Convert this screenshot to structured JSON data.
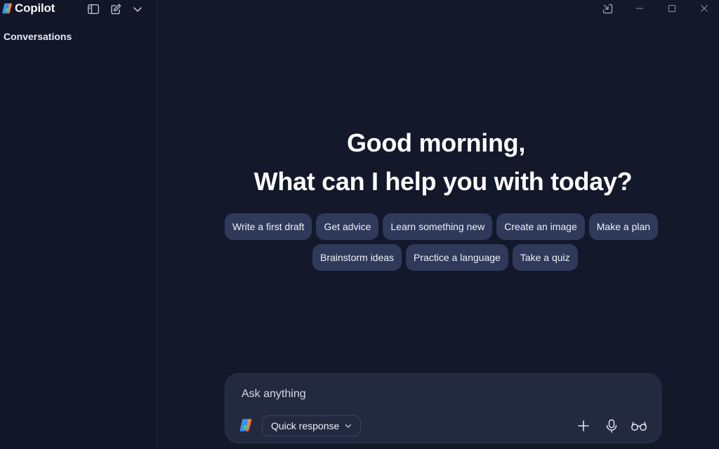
{
  "app": {
    "title": "Copilot"
  },
  "sidebar": {
    "heading": "Conversations"
  },
  "greeting": {
    "line1": "Good morning,",
    "line2": "What can I help you with today?"
  },
  "suggestions": {
    "row1": [
      "Write a first draft",
      "Get advice",
      "Learn something new",
      "Create an image",
      "Make a plan"
    ],
    "row2": [
      "Brainstorm ideas",
      "Practice a language",
      "Take a quiz"
    ]
  },
  "composer": {
    "placeholder": "Ask anything",
    "mode": "Quick response"
  },
  "icons": {
    "toolbar": [
      "sidebar-toggle-icon",
      "new-chat-icon",
      "chevron-down-icon"
    ],
    "window": [
      "pop-out-icon",
      "minimize-icon",
      "maximize-icon",
      "close-icon"
    ],
    "composer": [
      "plus-icon",
      "microphone-icon",
      "glasses-icon"
    ]
  },
  "colors": {
    "background": "#13182a",
    "sidebar": "#121626",
    "chip": "#2f3a5a",
    "composer": "#232a40"
  }
}
